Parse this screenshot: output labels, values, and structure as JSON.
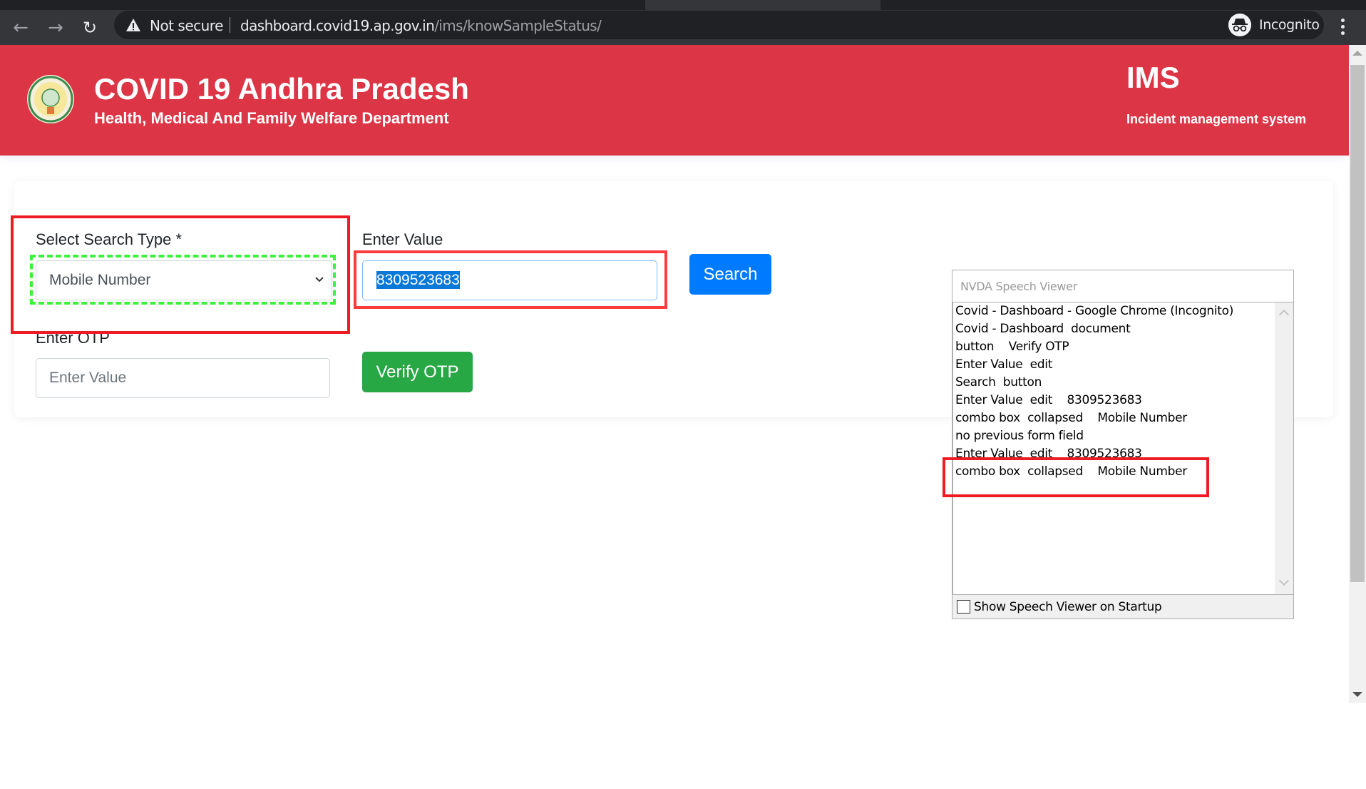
{
  "browser": {
    "back_icon": "arrow-left-icon",
    "forward_icon": "arrow-right-icon",
    "reload_icon": "reload-icon",
    "security_label": "Not secure",
    "url_host": "dashboard.covid19.ap.gov.in",
    "url_path": "/ims/knowSampleStatus/",
    "bookmark_icon": "star-icon",
    "profile_label": "Incognito",
    "menu_icon": "kebab-menu-icon"
  },
  "header": {
    "title": "COVID 19 Andhra Pradesh",
    "subtitle": "Health, Medical And Family Welfare Department",
    "right_title": "IMS",
    "right_subtitle": "Incident management system",
    "background_color": "#dc3545"
  },
  "form": {
    "search_type_label": "Select Search Type *",
    "search_type_value": "Mobile Number",
    "enter_value_label": "Enter Value",
    "enter_value_value": "8309523683",
    "search_button": "Search",
    "otp_label": "Enter OTP",
    "otp_placeholder": "Enter Value",
    "verify_button": "Verify OTP",
    "search_button_color": "#007bff",
    "verify_button_color": "#28a745"
  },
  "nvda": {
    "title": "NVDA Speech Viewer",
    "lines": [
      "Covid - Dashboard - Google Chrome (Incognito)",
      "Covid - Dashboard  document",
      "button    Verify OTP",
      "Enter Value  edit",
      "Search  button",
      "Enter Value  edit    8309523683",
      "combo box  collapsed    Mobile Number",
      "no previous form field",
      "Enter Value  edit    8309523683",
      "combo box  collapsed    Mobile Number"
    ],
    "startup_checkbox_label": "Show Speech Viewer on Startup",
    "startup_checkbox_checked": false
  },
  "annotations": {
    "highlight_color": "#ed1c24",
    "focus_outline_color": "#3cf23c"
  }
}
